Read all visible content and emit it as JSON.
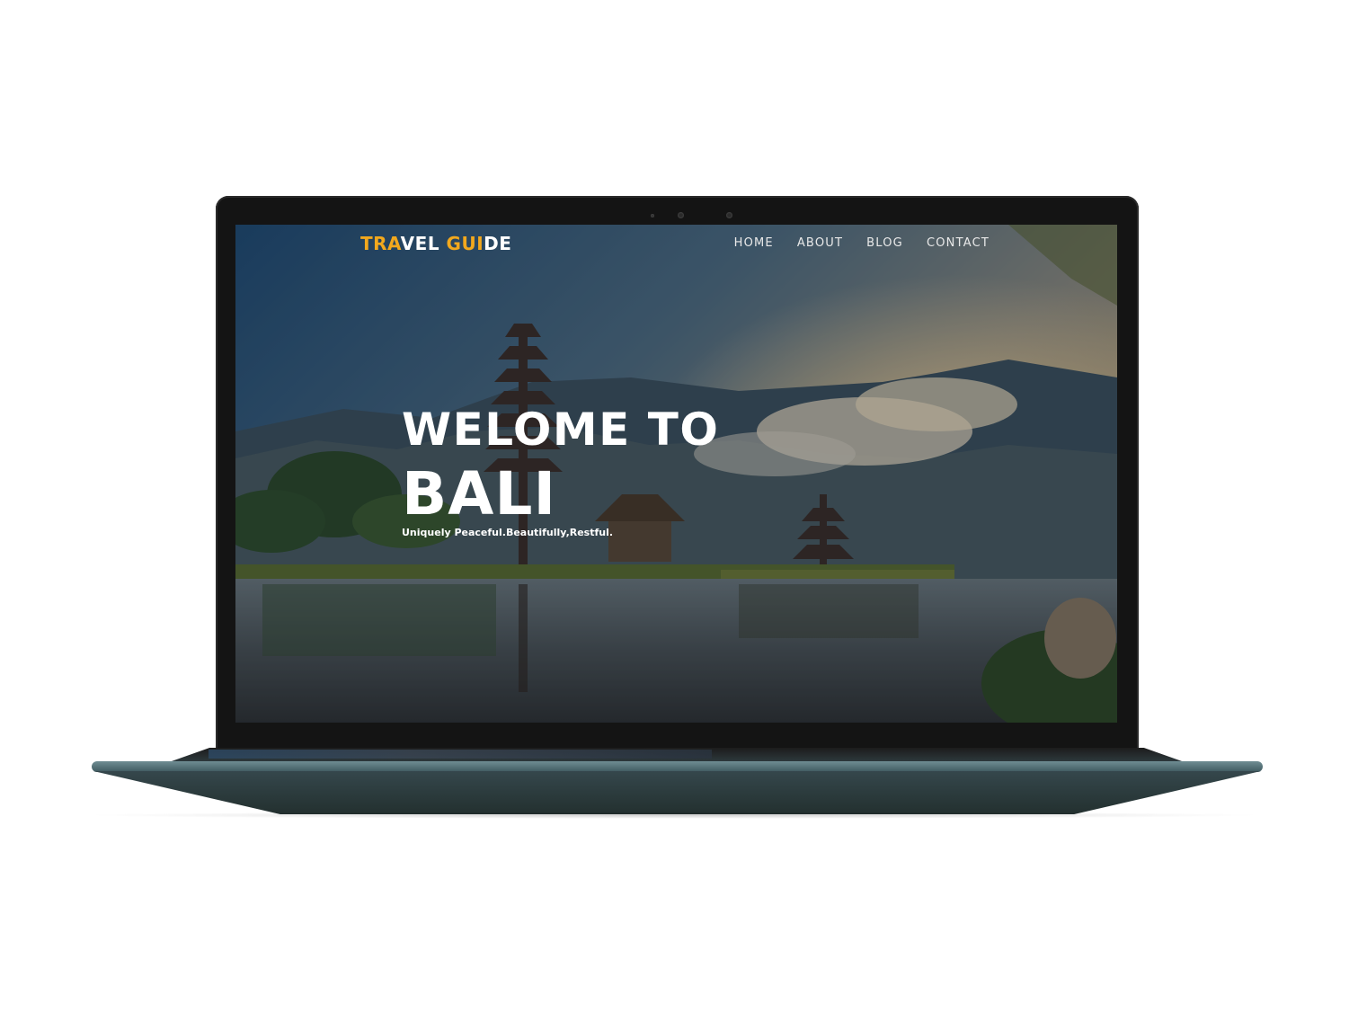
{
  "site": {
    "logo": {
      "part1": "TRA",
      "part2": "VEL ",
      "part3": "GUI",
      "part4": "DE"
    },
    "nav": {
      "items": [
        {
          "label": "HOME"
        },
        {
          "label": "ABOUT"
        },
        {
          "label": "BLOG"
        },
        {
          "label": "CONTACT"
        }
      ]
    },
    "hero": {
      "line1": "WELOME TO",
      "line2": "BALI",
      "subtitle": "Uniquely Peaceful.Beautifully,Restful."
    }
  },
  "colors": {
    "logo_accent": "#f2a81d",
    "logo_main": "#ffffff",
    "nav_text": "#e9e9e9",
    "hero_text": "#ffffff",
    "laptop_bezel": "#141414",
    "laptop_base": "#3f5a60"
  },
  "icons": {
    "webcam": "webcam-icon"
  }
}
